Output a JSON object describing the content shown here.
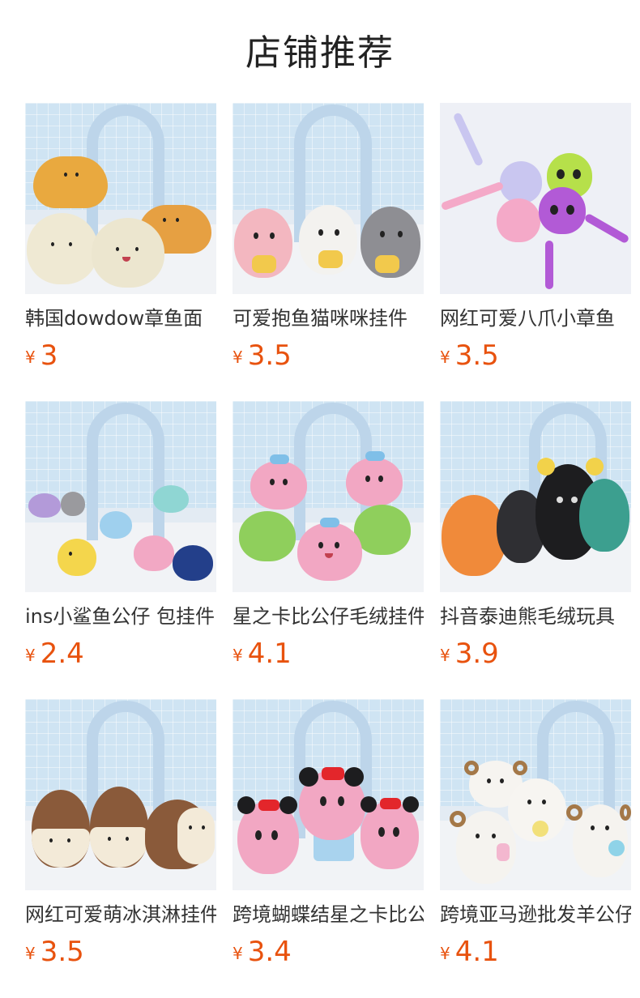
{
  "section": {
    "title": "店铺推荐"
  },
  "products": [
    {
      "name": "韩国dowdow章鱼面",
      "currency": "¥",
      "price": "3"
    },
    {
      "name": "可爱抱鱼猫咪咪挂件",
      "currency": "¥",
      "price": "3.5"
    },
    {
      "name": "网红可爱八爪小章鱼",
      "currency": "¥",
      "price": "3.5"
    },
    {
      "name": "ins小鲨鱼公仔 包挂件",
      "currency": "¥",
      "price": "2.4"
    },
    {
      "name": "星之卡比公仔毛绒挂件",
      "currency": "¥",
      "price": "4.1"
    },
    {
      "name": "抖音泰迪熊毛绒玩具",
      "currency": "¥",
      "price": "3.9"
    },
    {
      "name": "网红可爱萌冰淇淋挂件",
      "currency": "¥",
      "price": "3.5"
    },
    {
      "name": "跨境蝴蝶结星之卡比公",
      "currency": "¥",
      "price": "3.4"
    },
    {
      "name": "跨境亚马逊批发羊公仔",
      "currency": "¥",
      "price": "4.1"
    }
  ],
  "colors": {
    "price": "#e8520e",
    "title": "#222222",
    "name": "#333333"
  }
}
